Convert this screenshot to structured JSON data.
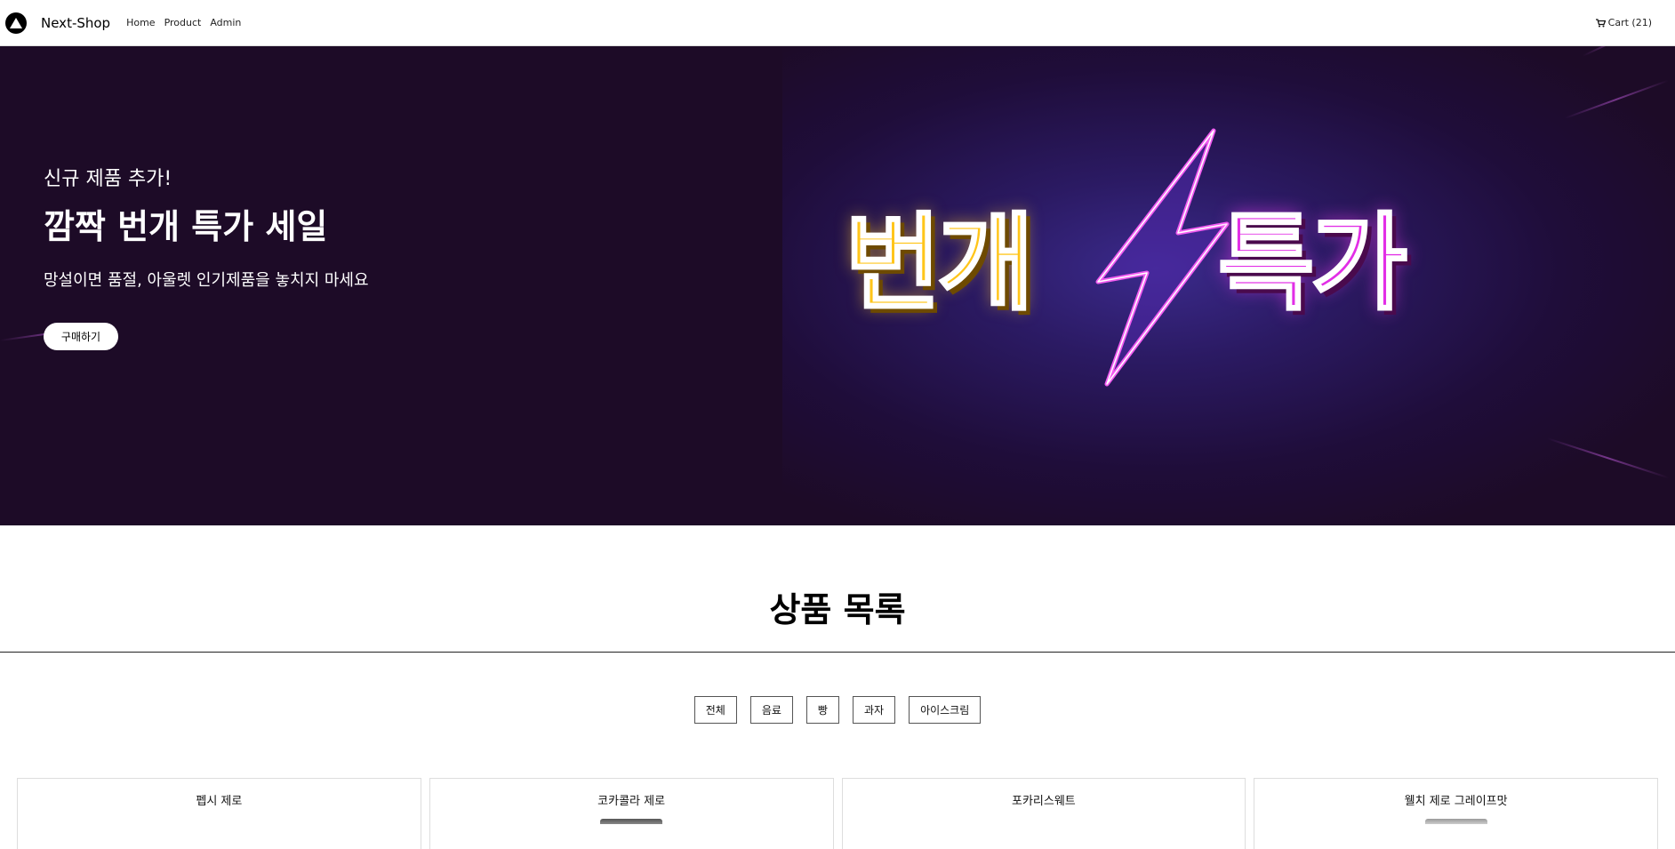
{
  "navbar": {
    "brand": "Next-Shop",
    "links": [
      "Home",
      "Product",
      "Admin"
    ],
    "cart_label": "Cart (21)"
  },
  "hero": {
    "subtitle": "신규 제품 추가!",
    "title": "깜짝 번개 특가 세일",
    "description": "망설이면 품절, 아울렛 인기제품을 놓치지 마세요",
    "button_label": "구매하기",
    "banner_text_left": "번개",
    "banner_text_right": "특가",
    "colors": {
      "background": "#1d0b27",
      "neon_yellow": "#ffc51a",
      "neon_pink": "#e22ee6"
    }
  },
  "products_section": {
    "title": "상품 목록",
    "filters": [
      "전체",
      "음료",
      "빵",
      "과자",
      "아이스크림"
    ],
    "products": [
      {
        "name": "펩시 제로",
        "thumb_icon": "none"
      },
      {
        "name": "코카콜라 제로",
        "thumb_icon": "can-icon"
      },
      {
        "name": "포카리스웨트",
        "thumb_icon": "none"
      },
      {
        "name": "웰치 제로 그레이프맛",
        "thumb_icon": "can-icon"
      }
    ]
  }
}
